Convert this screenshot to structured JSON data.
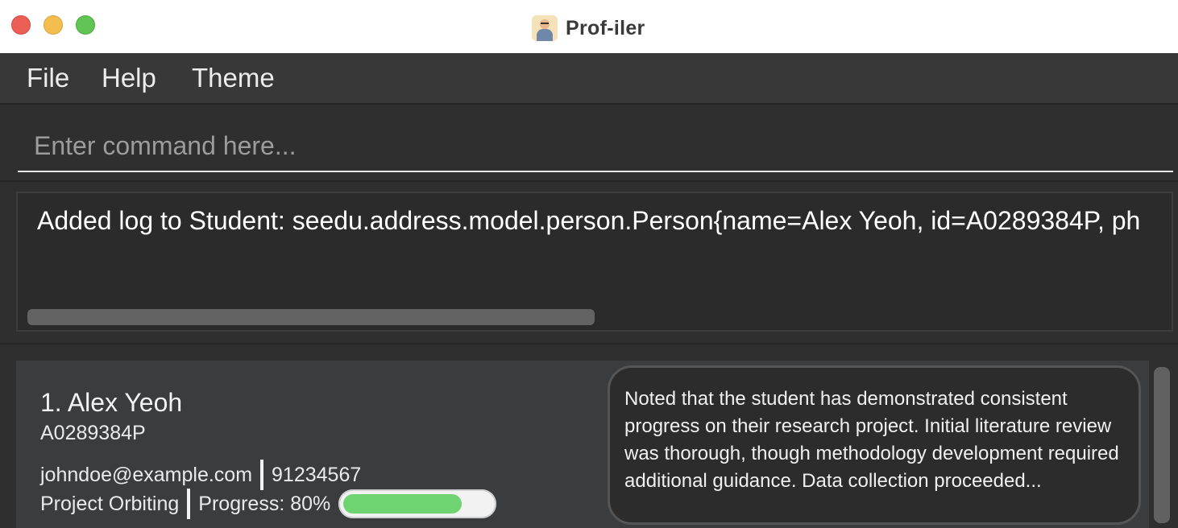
{
  "window": {
    "title": "Prof-iler"
  },
  "menu": {
    "items": [
      "File",
      "Help",
      "Theme"
    ]
  },
  "command": {
    "placeholder": "Enter command here...",
    "value": ""
  },
  "result": {
    "text": "Added log to Student: seedu.address.model.person.Person{name=Alex Yeoh, id=A0289384P, ph"
  },
  "students": [
    {
      "index_name": "1. Alex Yeoh",
      "id": "A0289384P",
      "email": "johndoe@example.com",
      "phone": "91234567",
      "project": "Project Orbiting",
      "progress_label": "Progress: 80%",
      "progress_value": 0.8,
      "log": "Noted that the student has demonstrated consistent progress on their research project. Initial literature review was thorough, though methodology development required additional guidance. Data collection proceeded..."
    }
  ],
  "colors": {
    "progress_fill": "#6fd371",
    "close": "#ec5f57",
    "minimize": "#f4bd4f",
    "maximize": "#61c454"
  }
}
